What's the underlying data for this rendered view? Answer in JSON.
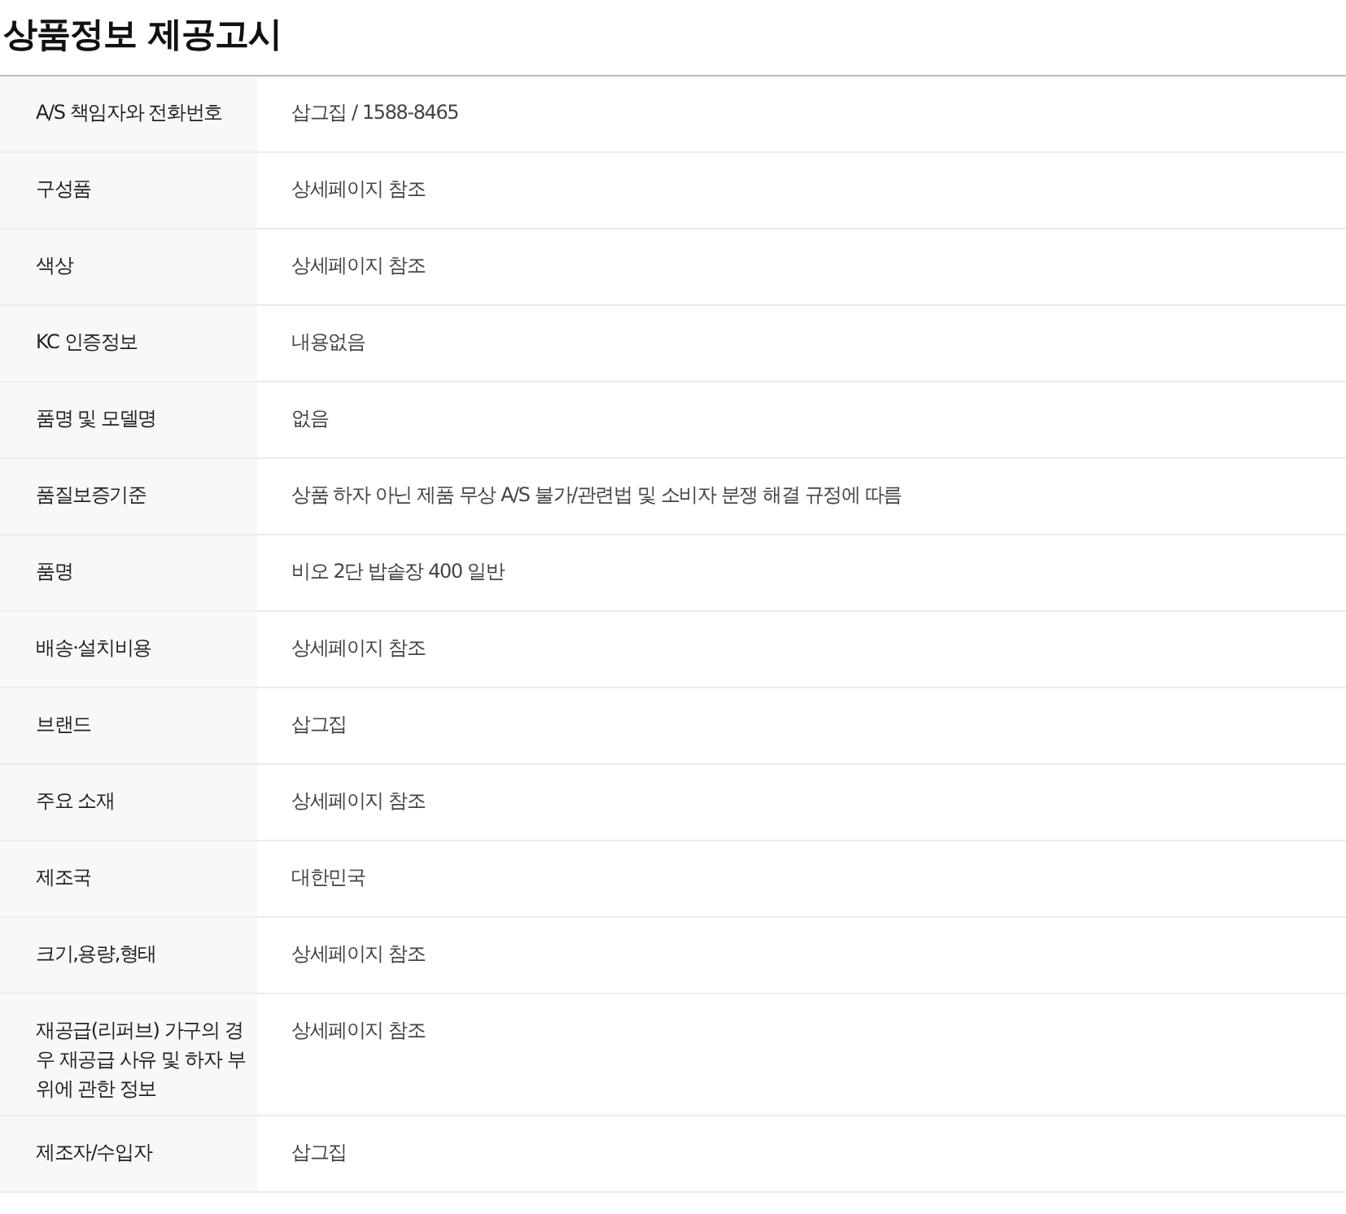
{
  "title": "상품정보 제공고시",
  "rows": [
    {
      "label": "A/S 책임자와 전화번호",
      "value": "삽그집 / 1588-8465"
    },
    {
      "label": "구성품",
      "value": "상세페이지 참조"
    },
    {
      "label": "색상",
      "value": "상세페이지 참조"
    },
    {
      "label": "KC 인증정보",
      "value": "내용없음"
    },
    {
      "label": "품명 및 모델명",
      "value": "없음"
    },
    {
      "label": "품질보증기준",
      "value": "상품 하자 아닌 제품 무상 A/S 불가/관련법 및 소비자 분쟁 해결 규정에 따름"
    },
    {
      "label": "품명",
      "value": "비오 2단 밥솥장 400 일반"
    },
    {
      "label": "배송·설치비용",
      "value": "상세페이지 참조"
    },
    {
      "label": "브랜드",
      "value": "삽그집"
    },
    {
      "label": "주요 소재",
      "value": "상세페이지 참조"
    },
    {
      "label": "제조국",
      "value": "대한민국"
    },
    {
      "label": "크기,용량,형태",
      "value": "상세페이지 참조"
    },
    {
      "label": "재공급(리퍼브) 가구의 경우 재공급 사유 및 하자 부위에 관한 정보",
      "value": "상세페이지 참조"
    },
    {
      "label": "제조자/수입자",
      "value": "삽그집"
    }
  ]
}
